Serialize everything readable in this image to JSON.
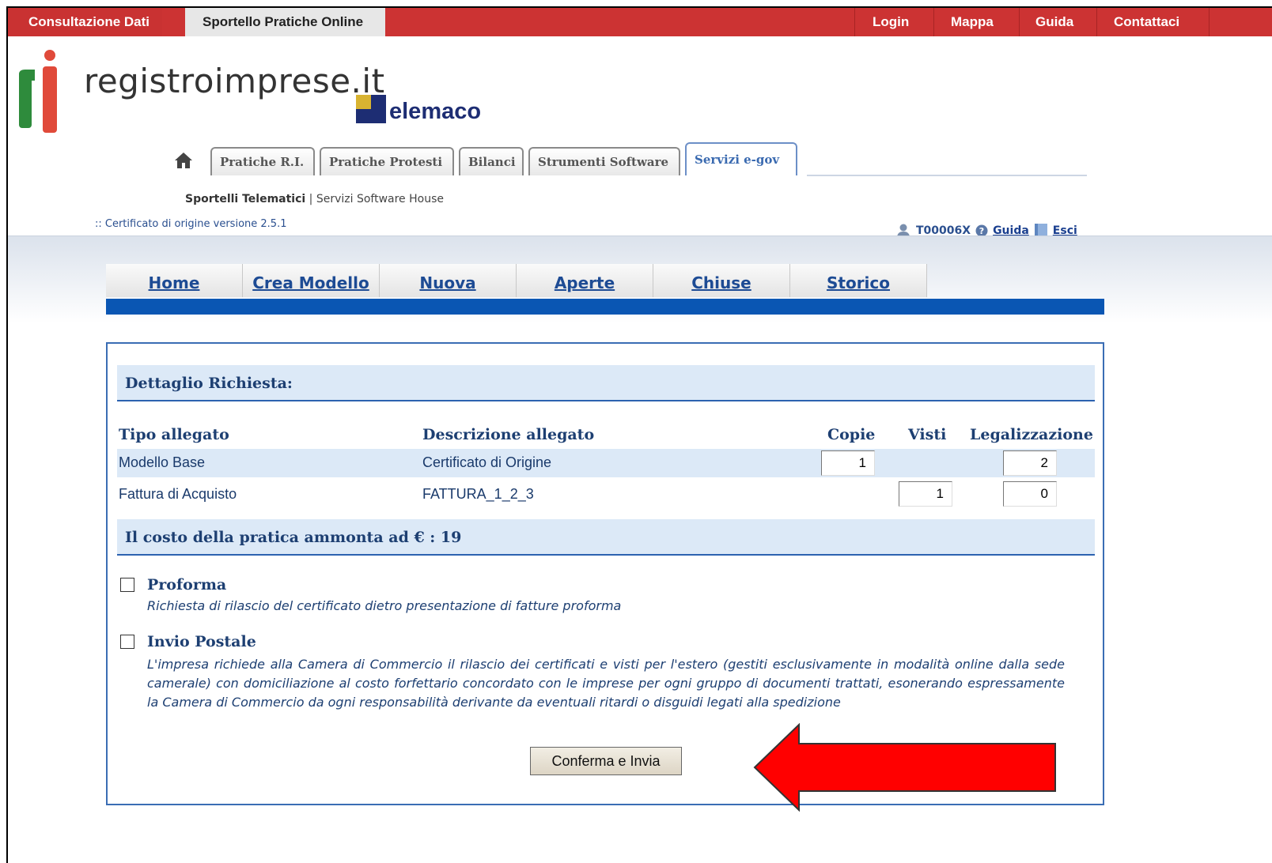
{
  "topbar": {
    "left_items": [
      "Consultazione Dati",
      "Sportello Pratiche Online"
    ],
    "right_items": [
      "Login",
      "Mappa",
      "Guida",
      "Contattaci"
    ]
  },
  "logo": {
    "text": "registroimprese.it",
    "partner": "Telemaco",
    "partner_suffix": "elemaco"
  },
  "folder_tabs": [
    "Pratiche R.I.",
    "Pratiche Protesti",
    "Bilanci",
    "Strumenti Software",
    "Servizi e-gov"
  ],
  "subnav": {
    "active": "Sportelli Telematici",
    "separator": "|",
    "other": "Servizi Software House"
  },
  "version_label": ":: Certificato di origine versione 2.5.1",
  "user": {
    "code": "T00006X",
    "guida": "Guida",
    "esci": "Esci"
  },
  "main_menu": [
    "Home",
    "Crea Modello",
    "Nuova",
    "Aperte",
    "Chiuse",
    "Storico"
  ],
  "detail": {
    "title": "Dettaglio Richiesta:",
    "columns": [
      "Tipo allegato",
      "Descrizione allegato",
      "Copie",
      "Visti",
      "Legalizzazione"
    ],
    "rows": [
      {
        "tipo": "Modello Base",
        "descrizione": "Certificato di Origine",
        "copie": "1",
        "visti": "",
        "legalizzazione": "2"
      },
      {
        "tipo": "Fattura di Acquisto",
        "descrizione": "FATTURA_1_2_3",
        "copie": "",
        "visti": "1",
        "legalizzazione": "0"
      }
    ],
    "cost_label": "Il costo della pratica ammonta ad € : 19"
  },
  "options": [
    {
      "title": "Proforma",
      "checked": false,
      "description": "Richiesta di rilascio del certificato dietro presentazione di fatture proforma"
    },
    {
      "title": "Invio Postale",
      "checked": false,
      "description": "L'impresa richiede alla Camera di Commercio il rilascio dei certificati e visti per l'estero (gestiti esclusivamente in modalità online dalla sede camerale) con domiciliazione al costo forfettario concordato con le imprese per ogni gruppo di documenti trattati, esonerando espressamente la Camera di Commercio da ogni responsabilità derivante da eventuali ritardi o disguidi legati alla spedizione"
    }
  ],
  "submit_label": "Conferma e Invia",
  "colors": {
    "topbar": "#cc3333",
    "menu_blue": "#0a56b3",
    "text_blue": "#1d3f72",
    "arrow": "#ff0000"
  }
}
